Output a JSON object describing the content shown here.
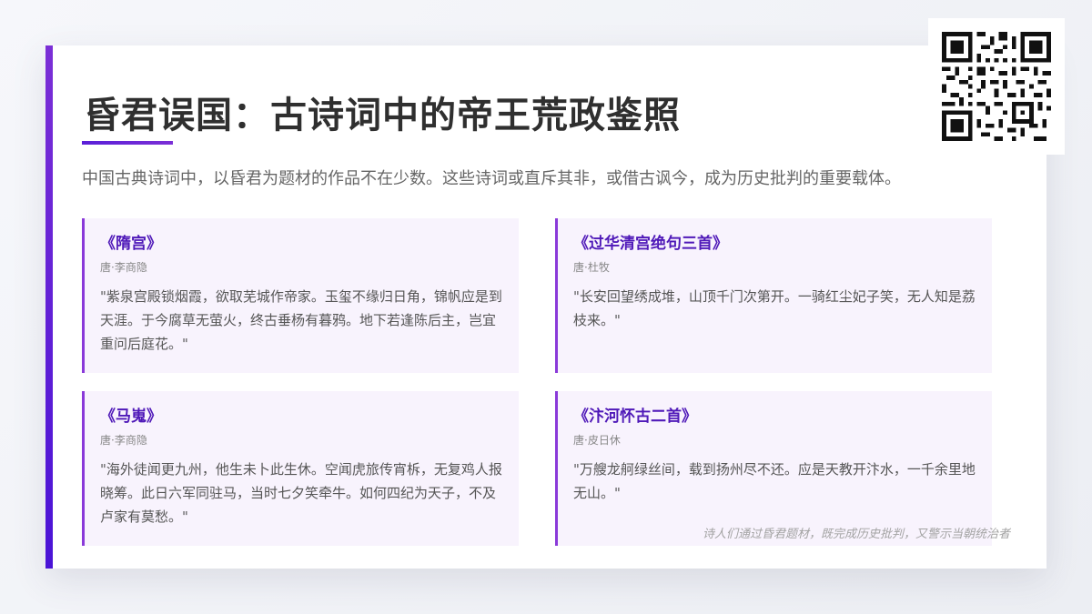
{
  "slide": {
    "title": "昏君误国：古诗词中的帝王荒政鉴照",
    "subtitle": "中国古典诗词中，以昏君为题材的作品不在少数。这些诗词或直斥其非，或借古讽今，成为历史批判的重要载体。",
    "poems": [
      {
        "title": "《隋宫》",
        "author": "唐·李商隐",
        "text": "\"紫泉宫殿锁烟霞，欲取芜城作帝家。玉玺不缘归日角，锦帆应是到天涯。于今腐草无萤火，终古垂杨有暮鸦。地下若逢陈后主，岂宜重问后庭花。\""
      },
      {
        "title": "《过华清宫绝句三首》",
        "author": "唐·杜牧",
        "text": "\"长安回望绣成堆，山顶千门次第开。一骑红尘妃子笑，无人知是荔枝来。\""
      },
      {
        "title": "《马嵬》",
        "author": "唐·李商隐",
        "text": "\"海外徒闻更九州，他生未卜此生休。空闻虎旅传宵柝，无复鸡人报晓筹。此日六军同驻马，当时七夕笑牵牛。如何四纪为天子，不及卢家有莫愁。\""
      },
      {
        "title": "《汴河怀古二首》",
        "author": "唐·皮日休",
        "text": "\"万艘龙舸绿丝间，载到扬州尽不还。应是天教开汴水，一千余里地无山。\""
      }
    ],
    "footer_note": "诗人们通过昏君题材，既完成历史批判，又警示当朝统治者"
  },
  "qr": {
    "icon": "qr-code-icon"
  },
  "colors": {
    "accent_purple": "#7b2fd6",
    "accent_blue": "#4a13d6",
    "poem_title": "#4f19b8",
    "card_bg": "#f8f3fd"
  }
}
